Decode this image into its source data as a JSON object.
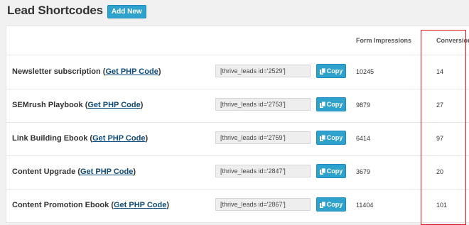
{
  "header": {
    "title": "Lead Shortcodes",
    "add_new_label": "Add New"
  },
  "table": {
    "columns": {
      "impressions": "Form Impressions",
      "conversions": "Conversions"
    },
    "php_link_label": "Get PHP Code",
    "copy_label": "Copy",
    "rows": [
      {
        "name": "Newsletter subscription",
        "shortcode": "[thrive_leads id='2529']",
        "impressions": "10245",
        "conversions": "14"
      },
      {
        "name": "SEMrush Playbook",
        "shortcode": "[thrive_leads id='2753']",
        "impressions": "9879",
        "conversions": "27"
      },
      {
        "name": "Link Building Ebook",
        "shortcode": "[thrive_leads id='2759']",
        "impressions": "6414",
        "conversions": "97"
      },
      {
        "name": "Content Upgrade",
        "shortcode": "[thrive_leads id='2847']",
        "impressions": "3679",
        "conversions": "20"
      },
      {
        "name": "Content Promotion Ebook",
        "shortcode": "[thrive_leads id='2867']",
        "impressions": "11404",
        "conversions": "101"
      }
    ]
  },
  "colors": {
    "accent": "#2ea2cc",
    "highlight": "#e0141e",
    "link": "#0e4a7a"
  }
}
